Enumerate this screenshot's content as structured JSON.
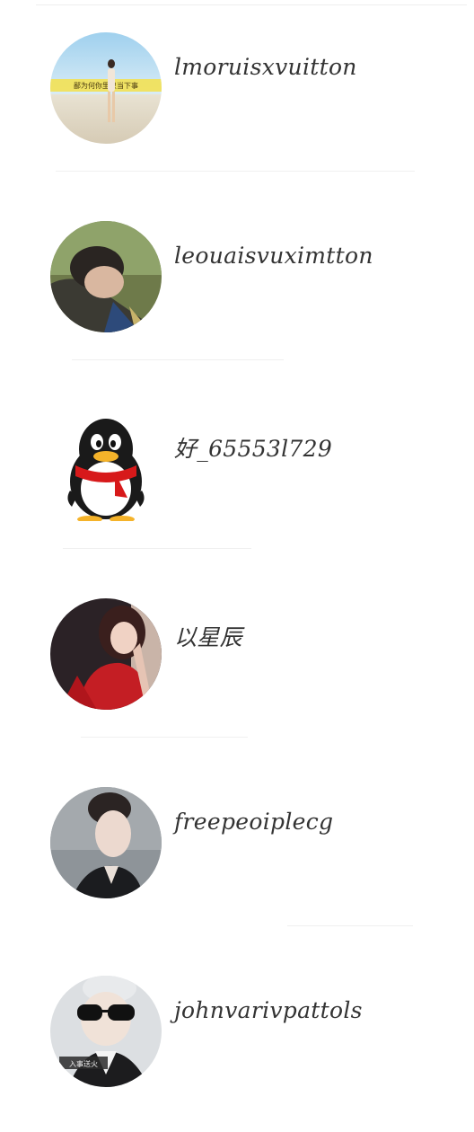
{
  "contacts": [
    {
      "name": "lmoruisxvuitton",
      "avatar": "beach-photo-avatar"
    },
    {
      "name": "leouaisvuximtton",
      "avatar": "young-man-photo-avatar"
    },
    {
      "name": "好_65553l729",
      "avatar": "qq-penguin-avatar"
    },
    {
      "name": "以星辰",
      "avatar": "woman-red-dress-photo-avatar"
    },
    {
      "name": "freepeoiplecg",
      "avatar": "man-portrait-avatar"
    },
    {
      "name": "johnvarivpattols",
      "avatar": "sunglasses-man-avatar"
    }
  ],
  "avatar_caption": "鄙为何你里只当下事",
  "avatar_tag": "入事送火",
  "colors": {
    "text": "#333333",
    "divider": "#f0f0f0",
    "background": "#ffffff"
  }
}
